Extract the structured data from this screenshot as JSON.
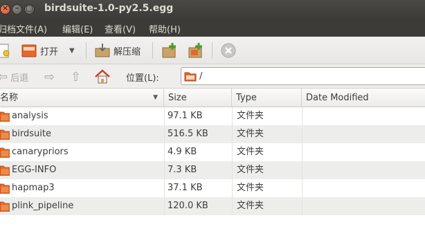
{
  "window": {
    "title": "birdsuite-1.0-py2.5.egg",
    "close_glyph": "×",
    "min_glyph": "–",
    "max_glyph": "□"
  },
  "menu": {
    "items": [
      "归档文件(A)",
      "编辑(E)",
      "查看(V)",
      "帮助(H)"
    ]
  },
  "toolbar": {
    "open_label": "打开",
    "extract_label": "解压缩"
  },
  "location": {
    "back_label": "后退",
    "location_label": "位置(L):",
    "path": "/"
  },
  "table": {
    "columns": [
      "名称",
      "Size",
      "Type",
      "Date Modified"
    ],
    "rows": [
      {
        "name": "analysis",
        "size": "97.1 KB",
        "type": "文件夹",
        "date": ""
      },
      {
        "name": "birdsuite",
        "size": "516.5 KB",
        "type": "文件夹",
        "date": ""
      },
      {
        "name": "canarypriors",
        "size": "4.9 KB",
        "type": "文件夹",
        "date": ""
      },
      {
        "name": "EGG-INFO",
        "size": "7.3 KB",
        "type": "文件夹",
        "date": ""
      },
      {
        "name": "hapmap3",
        "size": "37.1 KB",
        "type": "文件夹",
        "date": ""
      },
      {
        "name": "plink_pipeline",
        "size": "120.0 KB",
        "type": "文件夹",
        "date": ""
      }
    ]
  },
  "colors": {
    "titlebar": "#3c3b37",
    "close_button": "#e05f31",
    "folder": "#e46a2a"
  }
}
